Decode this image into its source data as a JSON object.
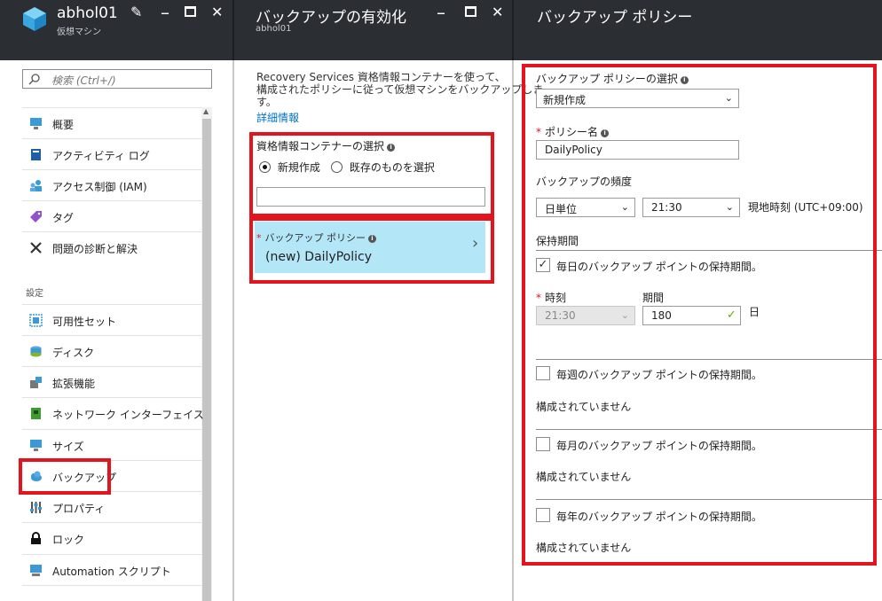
{
  "blade1": {
    "title": "abhol01",
    "subtitle": "仮想マシン",
    "search_placeholder": "検索 (Ctrl+/)",
    "section_label": "設定",
    "items": [
      {
        "label": "概要"
      },
      {
        "label": "アクティビティ ログ"
      },
      {
        "label": "アクセス制御 (IAM)"
      },
      {
        "label": "タグ"
      },
      {
        "label": "問題の診断と解決"
      },
      {
        "label": "可用性セット"
      },
      {
        "label": "ディスク"
      },
      {
        "label": "拡張機能"
      },
      {
        "label": "ネットワーク インターフェイス"
      },
      {
        "label": "サイズ"
      },
      {
        "label": "バックアップ"
      },
      {
        "label": "プロパティ"
      },
      {
        "label": "ロック"
      },
      {
        "label": "Automation スクリプト"
      }
    ]
  },
  "blade2": {
    "title": "バックアップの有効化",
    "subtitle": "abhol01",
    "description": "Recovery Services 資格情報コンテナーを使って、構成されたポリシーに従って仮想マシンをバックアップします。",
    "desc_lines": [
      "Recovery Services 資格情報コンテナーを使って、",
      "構成されたポリシーに従って仮想マシンをバックアップしま",
      "す。"
    ],
    "more_info_link": "詳細情報",
    "vault_label": "資格情報コンテナーの選択",
    "radio_new": "新規作成",
    "radio_existing": "既存のものを選択",
    "vault_name_value": "",
    "policy_label": "バックアップ ポリシー",
    "policy_value": "(new) DailyPolicy"
  },
  "blade3": {
    "title": "バックアップ ポリシー",
    "policy_select_label": "バックアップ ポリシーの選択",
    "policy_select_value": "新規作成",
    "policy_name_label": "ポリシー名",
    "policy_name_value": "DailyPolicy",
    "frequency_label": "バックアップの頻度",
    "frequency_value": "日単位",
    "time_value": "21:30",
    "timezone": "現地時刻 (UTC+09:00)",
    "retention_label": "保持期間",
    "daily_label": "毎日のバックアップ ポイントの保持期間。",
    "daily_checked": true,
    "time_label": "時刻",
    "duration_label": "期間",
    "retention_time_value": "21:30",
    "retention_days_value": "180",
    "day_unit": "日",
    "weekly_label": "毎週のバックアップ ポイントの保持期間。",
    "monthly_label": "毎月のバックアップ ポイントの保持期間。",
    "yearly_label": "毎年のバックアップ ポイントの保持期間。",
    "not_configured": "構成されていません"
  },
  "colors": {
    "header_bg": "#2b2f33",
    "highlight_red": "#e3141e",
    "policy_tile_bg": "#b3e6f7",
    "link": "#0072c6",
    "valid_check": "#5db300"
  }
}
